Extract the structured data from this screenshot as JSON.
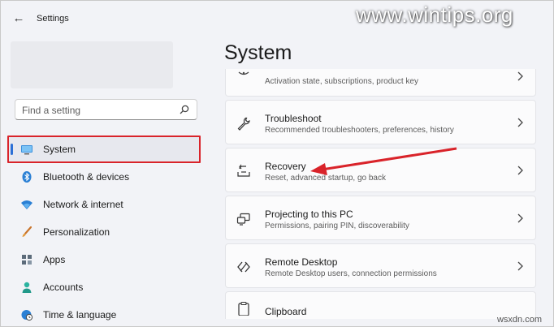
{
  "titlebar": {
    "title": "Settings"
  },
  "watermark": "www.wintips.org",
  "watermark_small": "wsxdn.com",
  "search": {
    "placeholder": "Find a setting"
  },
  "nav": {
    "items": [
      {
        "label": "System",
        "icon": "monitor-icon",
        "active": true
      },
      {
        "label": "Bluetooth & devices",
        "icon": "bluetooth-icon"
      },
      {
        "label": "Network & internet",
        "icon": "wifi-icon"
      },
      {
        "label": "Personalization",
        "icon": "brush-icon"
      },
      {
        "label": "Apps",
        "icon": "apps-icon"
      },
      {
        "label": "Accounts",
        "icon": "person-icon"
      },
      {
        "label": "Time & language",
        "icon": "globe-clock-icon"
      }
    ]
  },
  "main": {
    "title": "System",
    "cards": [
      {
        "title": "",
        "desc": "Activation state, subscriptions, product key",
        "icon": "activation-icon"
      },
      {
        "title": "Troubleshoot",
        "desc": "Recommended troubleshooters, preferences, history",
        "icon": "wrench-icon"
      },
      {
        "title": "Recovery",
        "desc": "Reset, advanced startup, go back",
        "icon": "recovery-icon"
      },
      {
        "title": "Projecting to this PC",
        "desc": "Permissions, pairing PIN, discoverability",
        "icon": "projector-icon"
      },
      {
        "title": "Remote Desktop",
        "desc": "Remote Desktop users, connection permissions",
        "icon": "remote-desktop-icon"
      },
      {
        "title": "Clipboard",
        "desc": "",
        "icon": "clipboard-icon"
      }
    ]
  },
  "colors": {
    "highlight_border": "#d9232a",
    "accent": "#2b6fd6",
    "annotation_arrow": "#d9232a"
  }
}
